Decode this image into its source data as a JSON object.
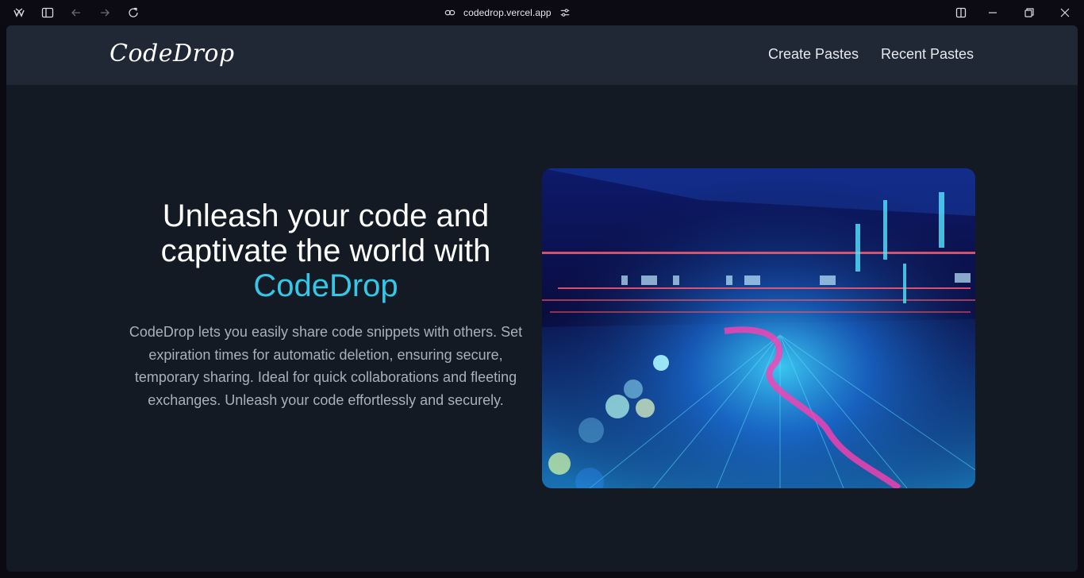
{
  "browser": {
    "url": "codedrop.vercel.app",
    "icons": {
      "app": "app-logo-icon",
      "sidebar": "sidebar-toggle-icon",
      "back": "back-arrow-icon",
      "forward": "forward-arrow-icon",
      "reload": "reload-icon",
      "link": "link-icon",
      "site_settings": "site-settings-icon",
      "split": "split-view-icon",
      "minimize": "minimize-icon",
      "restore": "restore-icon",
      "close": "close-icon"
    }
  },
  "navbar": {
    "logo": "CodeDrop",
    "links": [
      "Create Pastes",
      "Recent Pastes"
    ]
  },
  "hero": {
    "title_line1": "Unleash your code and",
    "title_line2": "captivate the world with",
    "title_accent": "CodeDrop",
    "description": "CodeDrop lets you easily share code snippets with others. Set expiration times for automatic deletion, ensuring secure, temporary sharing. Ideal for quick collaborations and fleeting exchanges. Unleash your code effortlessly and securely.",
    "image_alt": "digital data stream illustration"
  },
  "colors": {
    "accent": "#35c7e8",
    "background": "#131a24",
    "navbar": "#1f2834"
  }
}
